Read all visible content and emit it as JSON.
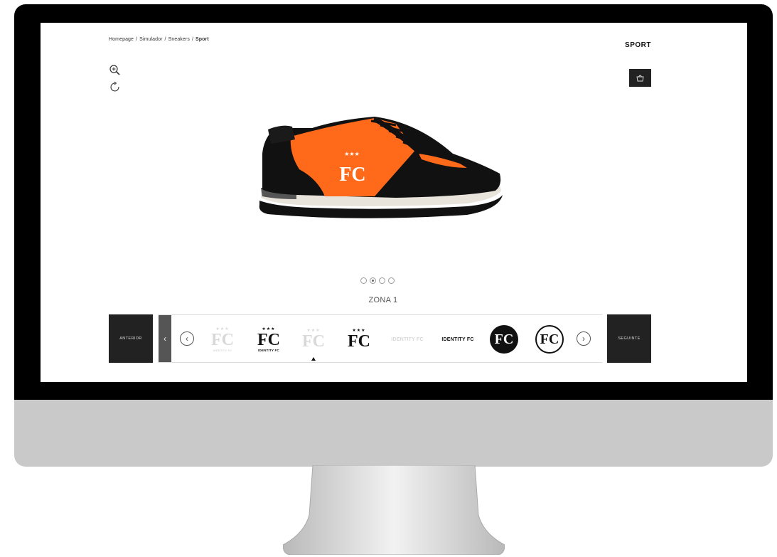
{
  "breadcrumb": [
    "Homepage",
    "Simulador",
    "Sneakers",
    "Sport"
  ],
  "breadcrumb_separator": "/",
  "product_title": "SPORT",
  "carousel_dots": {
    "count": 4,
    "active": 1
  },
  "zone_label": "ZONA 1",
  "nav": {
    "prev_label": "ANTERIOR",
    "next_label": "SEGUINTE"
  },
  "options": [
    {
      "stars": "★★★",
      "monogram": "FC",
      "word": "IDENTITY FC",
      "style": "faded"
    },
    {
      "stars": "★★★",
      "monogram": "FC",
      "word": "IDENTITY FC",
      "style": "dark"
    },
    {
      "stars": "★★★",
      "monogram": "FC",
      "word": "",
      "style": "faded"
    },
    {
      "stars": "★★★",
      "monogram": "FC",
      "word": "",
      "style": "dark"
    },
    {
      "word": "IDENTITY FC",
      "style": "faded"
    },
    {
      "word": "IDENTITY FC",
      "style": "dark"
    },
    {
      "monogram": "FC",
      "style": "badge-filled"
    },
    {
      "monogram": "FC",
      "style": "badge-outline"
    }
  ],
  "colors": {
    "upper": "#ff6a1a",
    "suede": "#111111",
    "sole": "#e8e4dc",
    "panel": "#222222"
  },
  "icons": {
    "zoom": "zoom-in-icon",
    "rotate": "rotate-icon",
    "cart": "shopping-bag-icon",
    "prev": "chevron-left-icon",
    "next": "chevron-right-icon"
  }
}
